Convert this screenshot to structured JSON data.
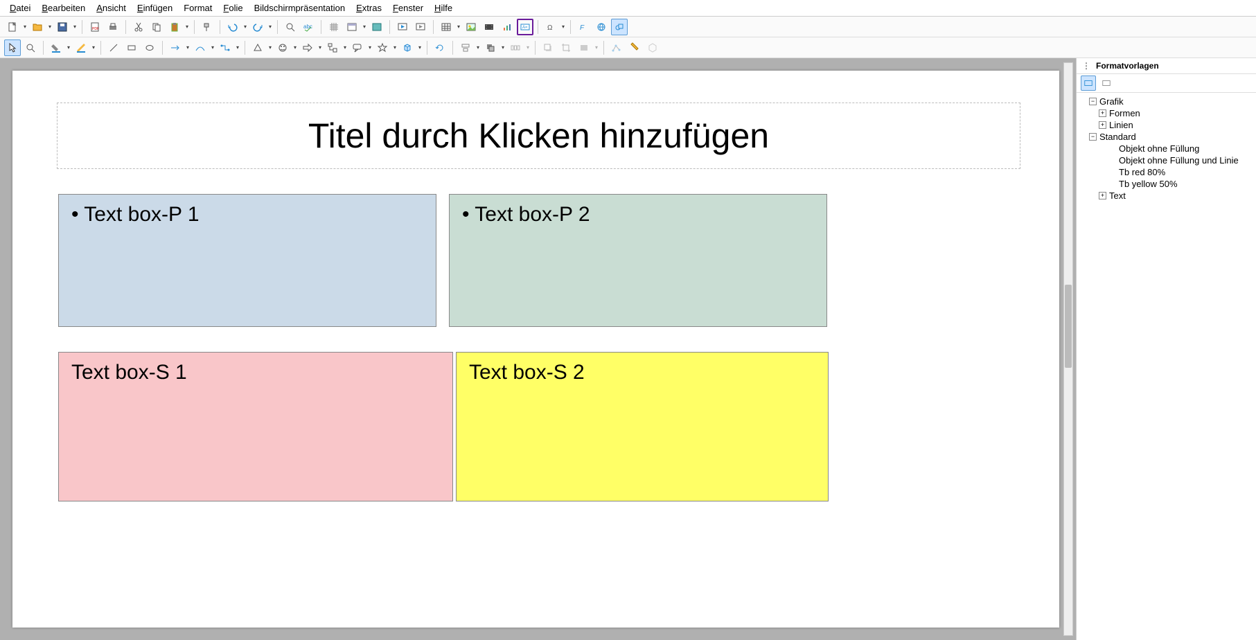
{
  "menubar": [
    {
      "label": "Datei",
      "u": 0
    },
    {
      "label": "Bearbeiten",
      "u": 0
    },
    {
      "label": "Ansicht",
      "u": 0
    },
    {
      "label": "Einfügen",
      "u": 0
    },
    {
      "label": "Format",
      "u": -1
    },
    {
      "label": "Folie",
      "u": 0
    },
    {
      "label": "Bildschirmpräsentation",
      "u": -1
    },
    {
      "label": "Extras",
      "u": 0
    },
    {
      "label": "Fenster",
      "u": 0
    },
    {
      "label": "Hilfe",
      "u": 0
    }
  ],
  "slide": {
    "title_placeholder": "Titel durch Klicken hinzufügen",
    "tb_p1": "Text box-P 1",
    "tb_p2": "Text box-P 2",
    "tb_s1": "Text box-S 1",
    "tb_s2": "Text box-S 2"
  },
  "sidebar": {
    "title": "Formatvorlagen",
    "tree": {
      "grafik": "Grafik",
      "formen": "Formen",
      "linien": "Linien",
      "standard": "Standard",
      "obj_ohne_fuell": "Objekt ohne Füllung",
      "obj_ohne_fuell_linie": "Objekt ohne Füllung und Linie",
      "tb_red": "Tb red 80%",
      "tb_yellow": "Tb yellow 50%",
      "text": "Text"
    }
  },
  "colors": {
    "tb_p1": "#cbdae8",
    "tb_p2": "#c9ddd3",
    "tb_s1": "#f9c6c9",
    "tb_s2": "#ffff66",
    "arrow_purple": "#6a1b9a",
    "arrow_red": "#e53935",
    "arrow_yellow": "#f9a825"
  }
}
